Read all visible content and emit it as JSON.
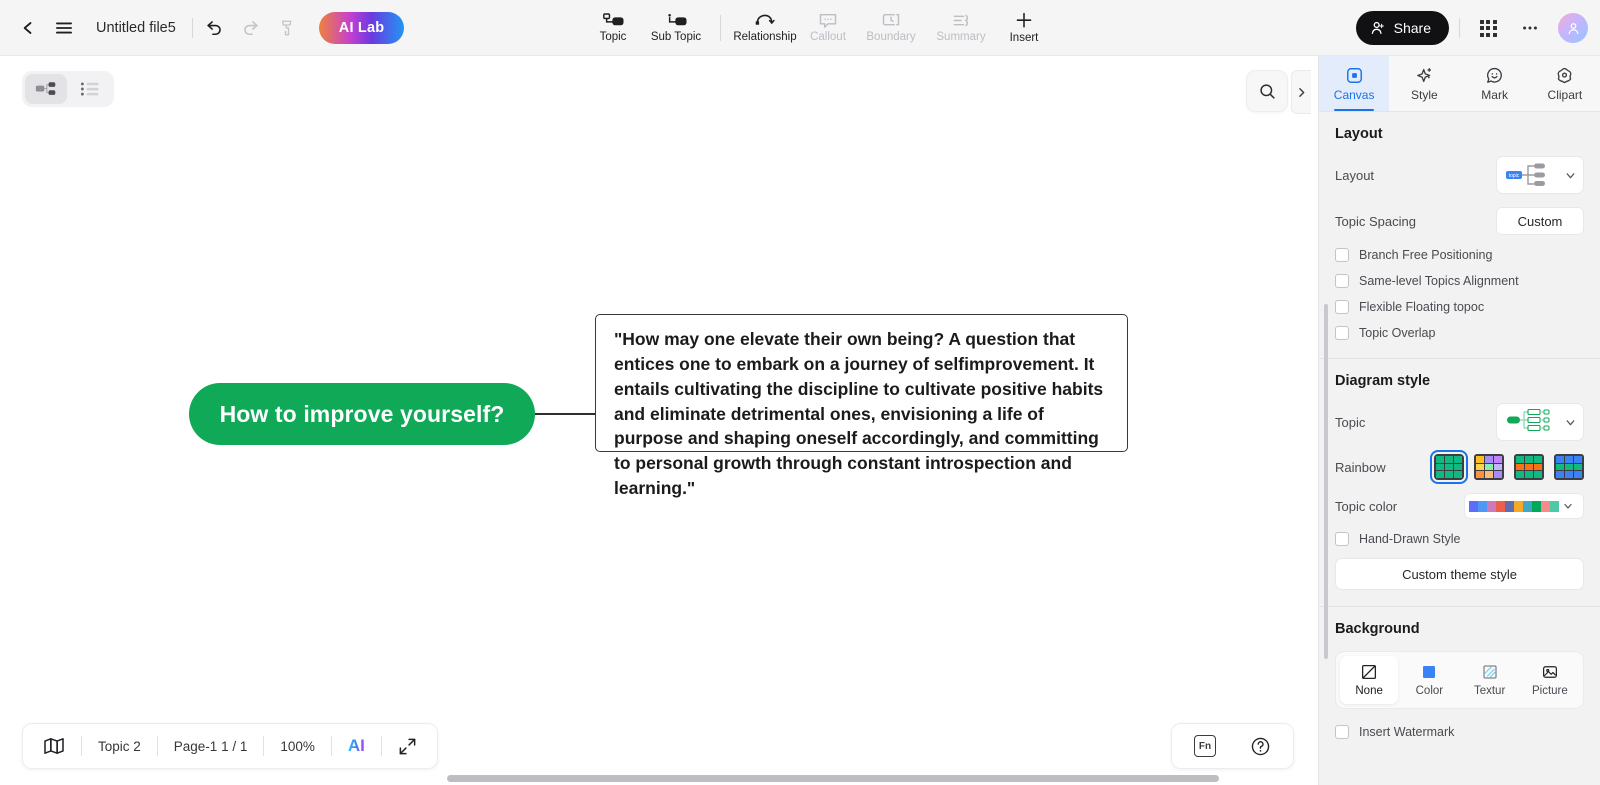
{
  "topbar": {
    "back": "back-arrow",
    "menu": "hamburger-menu",
    "file_name": "Untitled file5",
    "undo": "undo",
    "redo": "redo",
    "format_painter": "format-painter",
    "ai_lab": "AI Lab",
    "tools": [
      {
        "label": "Topic",
        "icon": "topic-icon",
        "disabled": false
      },
      {
        "label": "Sub Topic",
        "icon": "sub-topic-icon",
        "disabled": false
      },
      {
        "label": "Relationship",
        "icon": "relationship-icon",
        "disabled": false
      },
      {
        "label": "Callout",
        "icon": "callout-icon",
        "disabled": true
      },
      {
        "label": "Boundary",
        "icon": "boundary-icon",
        "disabled": true
      },
      {
        "label": "Summary",
        "icon": "summary-icon",
        "disabled": true
      },
      {
        "label": "Insert",
        "icon": "plus-icon",
        "disabled": false
      }
    ],
    "share": "Share",
    "apps": "apps-grid-icon",
    "more": "more-options-icon",
    "avatar": "user-avatar"
  },
  "canvas": {
    "view_toggle": [
      {
        "name": "mindmap-view",
        "active": true
      },
      {
        "name": "outline-view",
        "active": false
      }
    ],
    "search": "search-icon",
    "root_topic": "How to improve yourself?",
    "root_color": "#0fa958",
    "sub_topic": "\"How may one elevate their own being?  A question that entices one to embark on a journey of selfimprovement. It entails cultivating the discipline to cultivate positive habits and eliminate detrimental ones, envisioning a life of purpose and shaping oneself accordingly, and committing to personal growth through constant introspection and learning.\""
  },
  "statusbar": {
    "map_icon": "map-icon",
    "topic_count": "Topic 2",
    "page": "Page-1  1 / 1",
    "zoom": "100%",
    "ai": "AI",
    "fullscreen": "fullscreen-icon",
    "fn": "Fn",
    "help": "?"
  },
  "panel": {
    "collapse": "collapse-panel-arrow",
    "tabs": [
      {
        "label": "Canvas",
        "icon": "canvas-icon",
        "active": true
      },
      {
        "label": "Style",
        "icon": "sparkle-icon",
        "active": false
      },
      {
        "label": "Mark",
        "icon": "smiley-icon",
        "active": false
      },
      {
        "label": "Clipart",
        "icon": "clipart-icon",
        "active": false
      }
    ],
    "layout": {
      "title": "Layout",
      "layout_label": "Layout",
      "layout_value": "topic",
      "spacing_label": "Topic Spacing",
      "spacing_value": "Custom",
      "checkboxes": [
        {
          "label": "Branch Free Positioning",
          "checked": false
        },
        {
          "label": "Same-level Topics Alignment",
          "checked": false
        },
        {
          "label": "Flexible Floating topoc",
          "checked": false
        },
        {
          "label": "Topic Overlap",
          "checked": false
        }
      ]
    },
    "diagram_style": {
      "title": "Diagram style",
      "topic_label": "Topic",
      "rainbow_label": "Rainbow",
      "rainbow_presets": [
        {
          "selected": true,
          "colors": [
            "#10b981",
            "#10b981",
            "#10b981",
            "#10b981",
            "#10b981",
            "#10b981",
            "#10b981",
            "#10b981",
            "#10b981"
          ]
        },
        {
          "selected": false,
          "colors": [
            "#fbbf24",
            "#a78bfa",
            "#c084fc",
            "#fcd34d",
            "#86efac",
            "#c4b5fd",
            "#fb923c",
            "#fdba74",
            "#a78bfa"
          ]
        },
        {
          "selected": false,
          "colors": [
            "#10b981",
            "#10b981",
            "#10b981",
            "#f97316",
            "#f97316",
            "#f97316",
            "#10b981",
            "#10b981",
            "#10b981"
          ]
        },
        {
          "selected": false,
          "colors": [
            "#3b82f6",
            "#3b82f6",
            "#3b82f6",
            "#10b981",
            "#10b981",
            "#10b981",
            "#3b82f6",
            "#3b82f6",
            "#3b82f6"
          ]
        }
      ],
      "topic_color_label": "Topic color",
      "topic_colors": [
        "#5b6ef5",
        "#4f97f7",
        "#cc7bb8",
        "#ed5f4b",
        "#5f6cb0",
        "#f9a825",
        "#3fa9c4",
        "#00a859",
        "#f48a8a",
        "#4ec9a8"
      ],
      "hand_drawn": {
        "label": "Hand-Drawn Style",
        "checked": false
      },
      "custom_theme": "Custom theme style"
    },
    "background": {
      "title": "Background",
      "options": [
        {
          "label": "None",
          "icon": "none-icon",
          "active": true
        },
        {
          "label": "Color",
          "icon": "color-icon",
          "active": false
        },
        {
          "label": "Textur",
          "icon": "texture-icon",
          "active": false
        },
        {
          "label": "Picture",
          "icon": "picture-icon",
          "active": false
        }
      ],
      "watermark": {
        "label": "Insert Watermark",
        "checked": false
      }
    }
  }
}
